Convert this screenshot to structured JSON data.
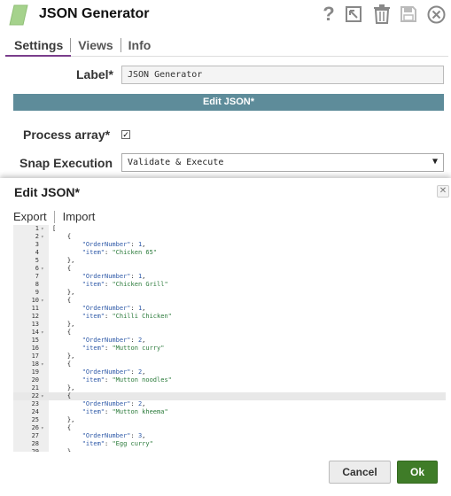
{
  "header": {
    "title": "JSON Generator",
    "help_glyph": "?",
    "icons": [
      "snap-pipeline-icon",
      "help-icon",
      "export-icon",
      "delete-icon",
      "save-icon",
      "close-icon"
    ],
    "accent_color": "#a5d28c"
  },
  "tabs": [
    {
      "label": "Settings",
      "active": true
    },
    {
      "label": "Views",
      "active": false
    },
    {
      "label": "Info",
      "active": false
    }
  ],
  "form": {
    "label_label": "Label*",
    "label_value": "JSON Generator",
    "edit_json_button": "Edit JSON*",
    "process_array_label": "Process array*",
    "process_array_checked": true,
    "process_array_mark": "✓",
    "snap_execution_label": "Snap Execution",
    "snap_execution_value": "Validate & Execute",
    "select_arrow": "▼"
  },
  "editor_dialog": {
    "title": "Edit JSON*",
    "close_glyph": "✕",
    "menu": {
      "export": "Export",
      "import": "Import"
    },
    "highlighted_line": 22,
    "lines": [
      {
        "n": "1",
        "fold": "▾",
        "text": "["
      },
      {
        "n": "2",
        "fold": "▾",
        "text": "    {"
      },
      {
        "n": "3",
        "fold": "",
        "text": "        \"OrderNumber\": 1,"
      },
      {
        "n": "4",
        "fold": "",
        "text": "        \"item\": \"Chicken 65\""
      },
      {
        "n": "5",
        "fold": "",
        "text": "    },"
      },
      {
        "n": "6",
        "fold": "▾",
        "text": "    {"
      },
      {
        "n": "7",
        "fold": "",
        "text": "        \"OrderNumber\": 1,"
      },
      {
        "n": "8",
        "fold": "",
        "text": "        \"item\": \"Chicken Grill\""
      },
      {
        "n": "9",
        "fold": "",
        "text": "    },"
      },
      {
        "n": "10",
        "fold": "▾",
        "text": "    {"
      },
      {
        "n": "11",
        "fold": "",
        "text": "        \"OrderNumber\": 1,"
      },
      {
        "n": "12",
        "fold": "",
        "text": "        \"item\": \"Chilli Chicken\""
      },
      {
        "n": "13",
        "fold": "",
        "text": "    },"
      },
      {
        "n": "14",
        "fold": "▾",
        "text": "    {"
      },
      {
        "n": "15",
        "fold": "",
        "text": "        \"OrderNumber\": 2,"
      },
      {
        "n": "16",
        "fold": "",
        "text": "        \"item\": \"Mutton curry\""
      },
      {
        "n": "17",
        "fold": "",
        "text": "    },"
      },
      {
        "n": "18",
        "fold": "▾",
        "text": "    {"
      },
      {
        "n": "19",
        "fold": "",
        "text": "        \"OrderNumber\": 2,"
      },
      {
        "n": "20",
        "fold": "",
        "text": "        \"item\": \"Mutton noodles\""
      },
      {
        "n": "21",
        "fold": "",
        "text": "    },"
      },
      {
        "n": "22",
        "fold": "▾",
        "text": "    {"
      },
      {
        "n": "23",
        "fold": "",
        "text": "        \"OrderNumber\": 2,"
      },
      {
        "n": "24",
        "fold": "",
        "text": "        \"item\": \"Mutton kheema\""
      },
      {
        "n": "25",
        "fold": "",
        "text": "    },"
      },
      {
        "n": "26",
        "fold": "▾",
        "text": "    {"
      },
      {
        "n": "27",
        "fold": "",
        "text": "        \"OrderNumber\": 3,"
      },
      {
        "n": "28",
        "fold": "",
        "text": "        \"item\": \"Egg curry\""
      },
      {
        "n": "29",
        "fold": "",
        "text": "    }"
      }
    ]
  },
  "buttons": {
    "cancel": "Cancel",
    "ok": "Ok",
    "ok_color": "#3f7c28"
  }
}
